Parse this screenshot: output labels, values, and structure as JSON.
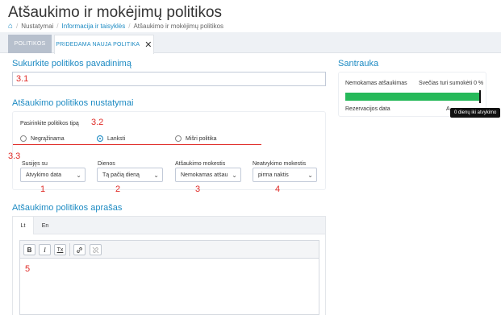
{
  "page": {
    "title": "Atšaukimo ir mokėjimų politikos"
  },
  "breadcrumb": {
    "items": [
      "Nustatymai",
      "Informacija ir taisyklės",
      "Atšaukimo ir mokėjimų politikos"
    ]
  },
  "tabs": {
    "inactive": "POLITIKOS",
    "active": "PRIDEDAMA NAUJA POLITIKA"
  },
  "name_section": {
    "title": "Sukurkite politikos pavadinimą",
    "marker": "3.1"
  },
  "settings": {
    "title": "Atšaukimo politikos nustatymai",
    "type_label": "Pasirinkite politikos tipą",
    "type_marker": "3.2",
    "options": [
      "Negrąžinama",
      "Lanksti",
      "Mišri politika"
    ],
    "selected_option": "Lanksti",
    "row_marker": "3.3",
    "fields": [
      {
        "label": "Susijęs su",
        "value": "Atvykimo data",
        "marker": "1"
      },
      {
        "label": "Dienos",
        "value": "Tą pačią dieną",
        "marker": "2"
      },
      {
        "label": "Atšaukimo mokestis",
        "value": "Nemokamas atšaukimas",
        "marker": "3"
      },
      {
        "label": "Neatvykimo mokestis",
        "value": "pirma naktis",
        "marker": "4"
      }
    ]
  },
  "summary": {
    "title": "Santrauka",
    "left_label": "Nemokamas atšaukimas",
    "right_label": "Svečias turi sumokėti 0 %",
    "bottom_left": "Rezervacijos data",
    "bottom_right": "A",
    "tooltip": "0 dienų iki atvykimo",
    "bar_fraction": 1.0,
    "bar_color": "#26b95a"
  },
  "description": {
    "title": "Atšaukimo politikos aprašas",
    "languages": [
      "Lt",
      "En"
    ],
    "active_language": "Lt",
    "toolbar": {
      "bold": "B",
      "italic": "I",
      "clear": "Tx"
    },
    "marker": "5"
  }
}
